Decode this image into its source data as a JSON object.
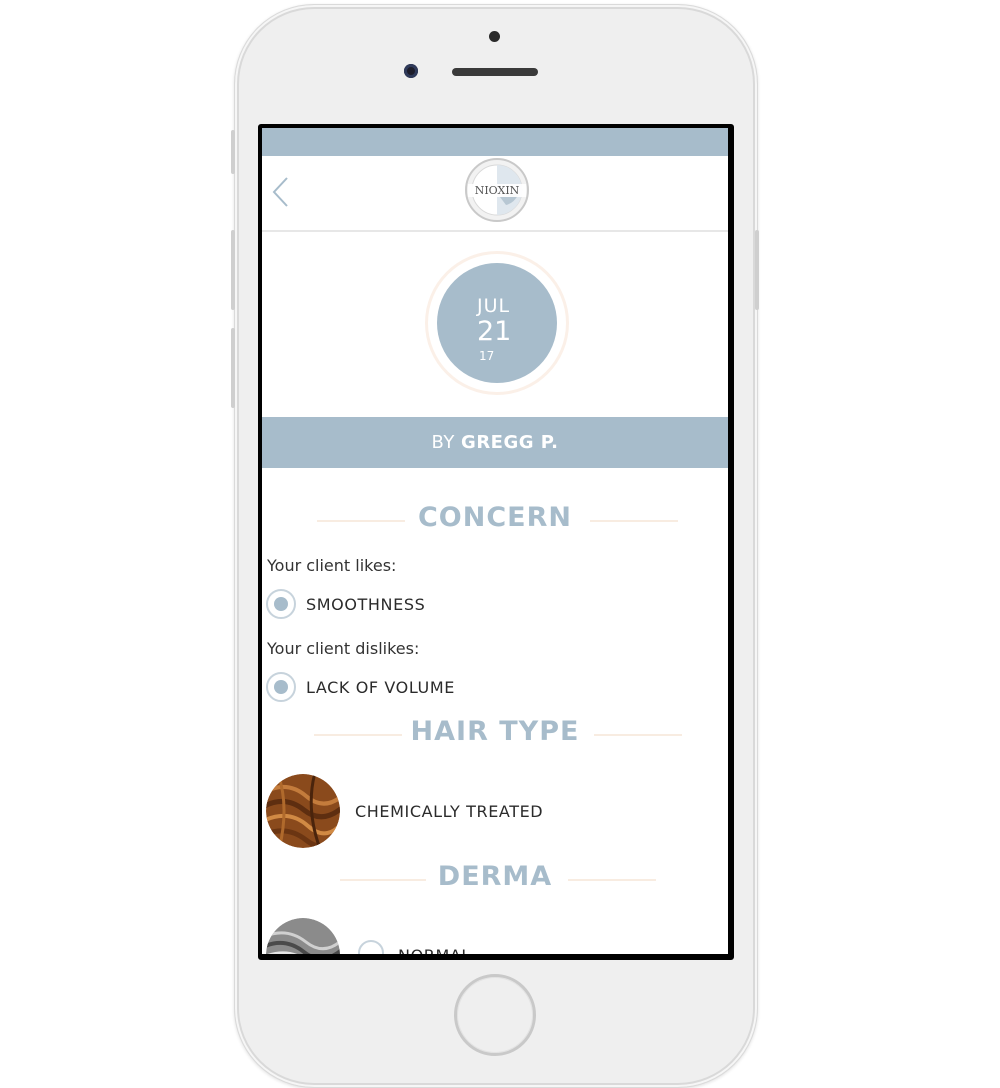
{
  "header": {
    "logo_text": "NIOXIN"
  },
  "appointment": {
    "month": "JUL",
    "day": "21",
    "year": "17"
  },
  "stylist": {
    "prefix": "BY",
    "name": "GREGG P."
  },
  "concern": {
    "heading": "CONCERN",
    "likes_label": "Your client likes:",
    "likes_value": "SMOOTHNESS",
    "dislikes_label": "Your client dislikes:",
    "dislikes_value": "LACK OF VOLUME"
  },
  "hair_type": {
    "heading": "HAIR TYPE",
    "value": "CHEMICALLY TREATED"
  },
  "derma": {
    "heading": "DERMA",
    "value": "NORMAL"
  },
  "colors": {
    "accent": "#a7bccb",
    "divider": "#f8ece1"
  }
}
